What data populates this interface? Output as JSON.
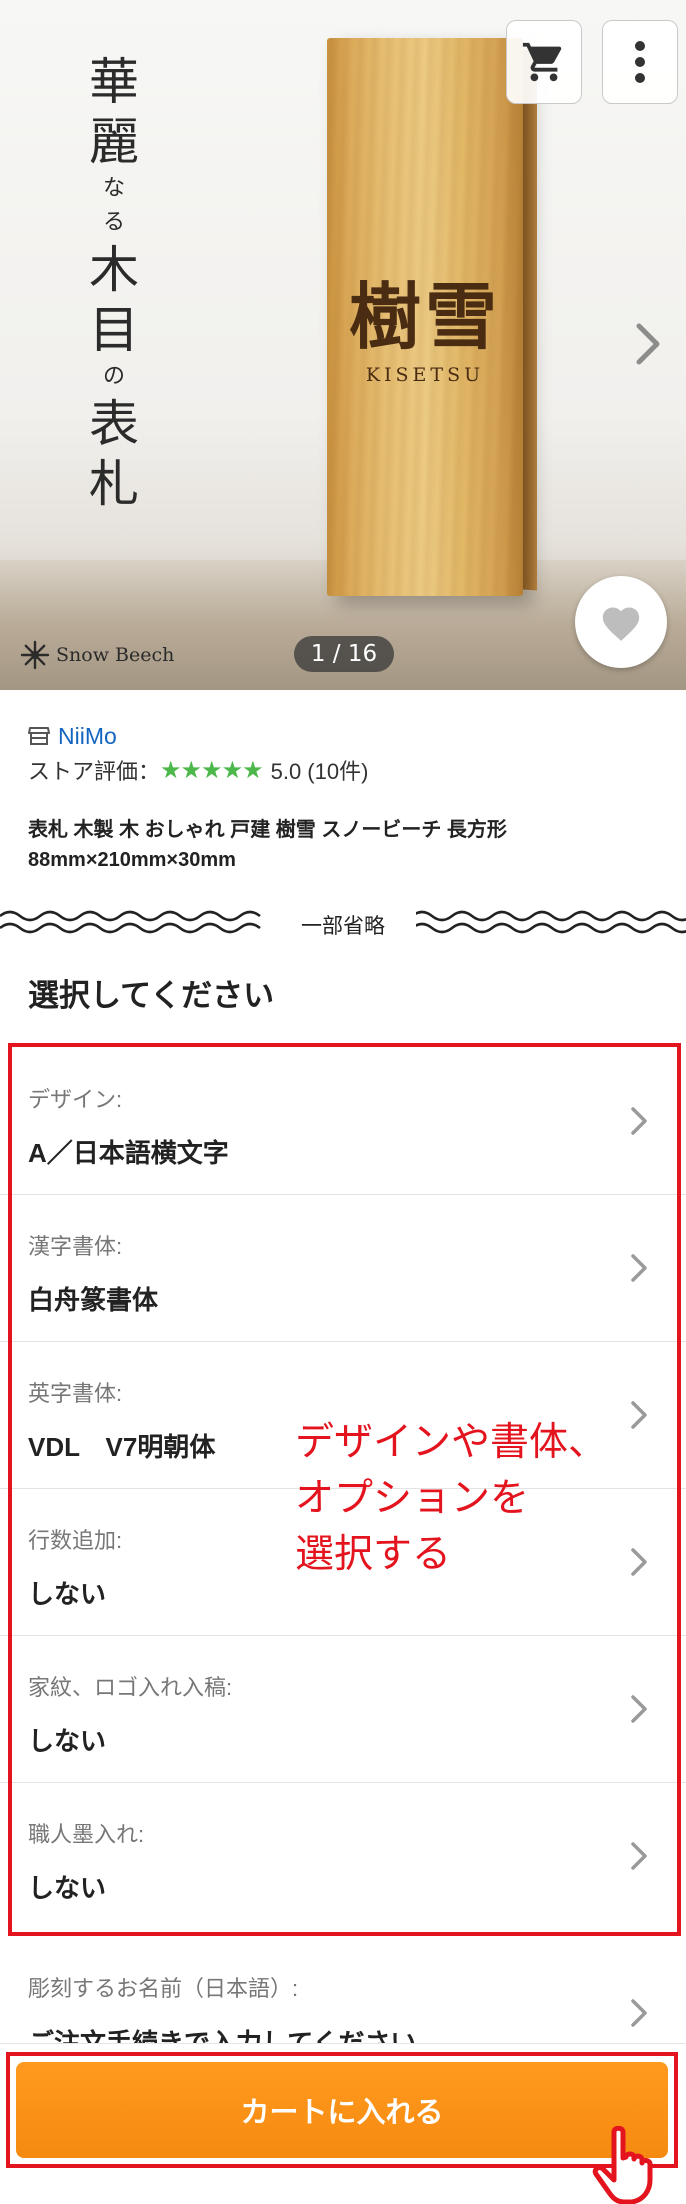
{
  "hero": {
    "copy_big": [
      "華",
      "麗",
      "木",
      "目",
      "表",
      "札"
    ],
    "copy_small": [
      "な",
      "る",
      "の"
    ],
    "sign_kanji": "樹雪",
    "sign_roman": "KISETSU",
    "brand": "Snow Beech",
    "counter": "1 / 16"
  },
  "store": {
    "name": "NiiMo",
    "rating_label": "ストア評価：",
    "stars": "★★★★★",
    "rating_value": "5.0 (10件)"
  },
  "product": {
    "title_line1": "表札 木製 木 おしゃれ 戸建 樹雪 スノービーチ 長方形",
    "title_line2": "88mm×210mm×30mm"
  },
  "omit_label": "一部省略",
  "section_title": "選択してください",
  "options": [
    {
      "label": "デザイン:",
      "value": "A／日本語横文字"
    },
    {
      "label": "漢字書体:",
      "value": "白舟篆書体"
    },
    {
      "label": "英字書体:",
      "value": "VDL　V7明朝体"
    },
    {
      "label": "行数追加:",
      "value": "しない"
    },
    {
      "label": "家紋、ロゴ入れ入稿:",
      "value": "しない"
    },
    {
      "label": "職人墨入れ:",
      "value": "しない"
    }
  ],
  "partial_option": {
    "label": "彫刻するお名前（日本語）:",
    "value": "ご注文手続きで入力してください"
  },
  "annotation": "デザインや書体、\nオプションを\n選択する",
  "cart_button": "カートに入れる",
  "colors": {
    "accent_orange": "#f68a10",
    "highlight_red": "#e4141e",
    "link_blue": "#1565c0",
    "star_green": "#4cb84c"
  }
}
